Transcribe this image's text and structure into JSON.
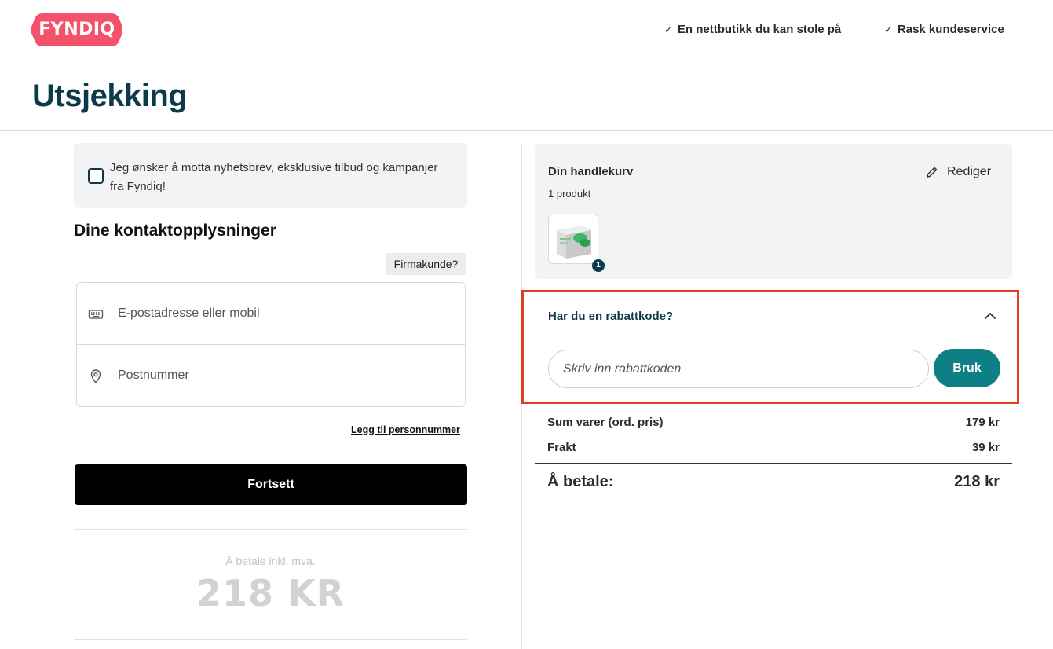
{
  "header": {
    "logo_text": "FYNDIQ",
    "brand_color": "#f4526b",
    "usps": [
      "En nettbutikk du kan stole på",
      "Rask kundeservice"
    ],
    "check_icon": "check-icon"
  },
  "page": {
    "title": "Utsjekking"
  },
  "newsletter": {
    "checked": false,
    "label": "Jeg ønsker å motta nyhetsbrev, eksklusive tilbud og kampanjer fra Fyndiq!"
  },
  "contact": {
    "heading": "Dine kontaktopplysninger",
    "business_button": "Firmakunde?",
    "email_field": {
      "value": "",
      "placeholder": "E-postadresse eller mobil",
      "icon": "keyboard-icon"
    },
    "postcode_field": {
      "value": "",
      "placeholder": "Postnummer",
      "icon": "location-pin-icon"
    },
    "add_ssn_link": "Legg til personnummer",
    "continue_button": "Fortsett"
  },
  "payment_summary": {
    "label": "Å betale inkl. mva.",
    "amount": "218 KR"
  },
  "cart": {
    "title": "Din handlekurv",
    "count": "1 produkt",
    "edit_label": "Rediger",
    "item_quantity": "1"
  },
  "discount": {
    "title": "Har du en rabattkode?",
    "expanded": true,
    "input_value": "",
    "input_placeholder": "Skriv inn rabattkoden",
    "apply_button": "Bruk",
    "highlight_color": "#e63c1e",
    "button_color": "#0f7f86"
  },
  "totals": {
    "items_label": "Sum varer (ord. pris)",
    "items_value": "179 kr",
    "shipping_label": "Frakt",
    "shipping_value": "39 kr",
    "total_label": "Å betale:",
    "total_value": "218 kr"
  },
  "colors": {
    "heading": "#0b3a4a",
    "panel_bg": "#f2f3f4"
  }
}
